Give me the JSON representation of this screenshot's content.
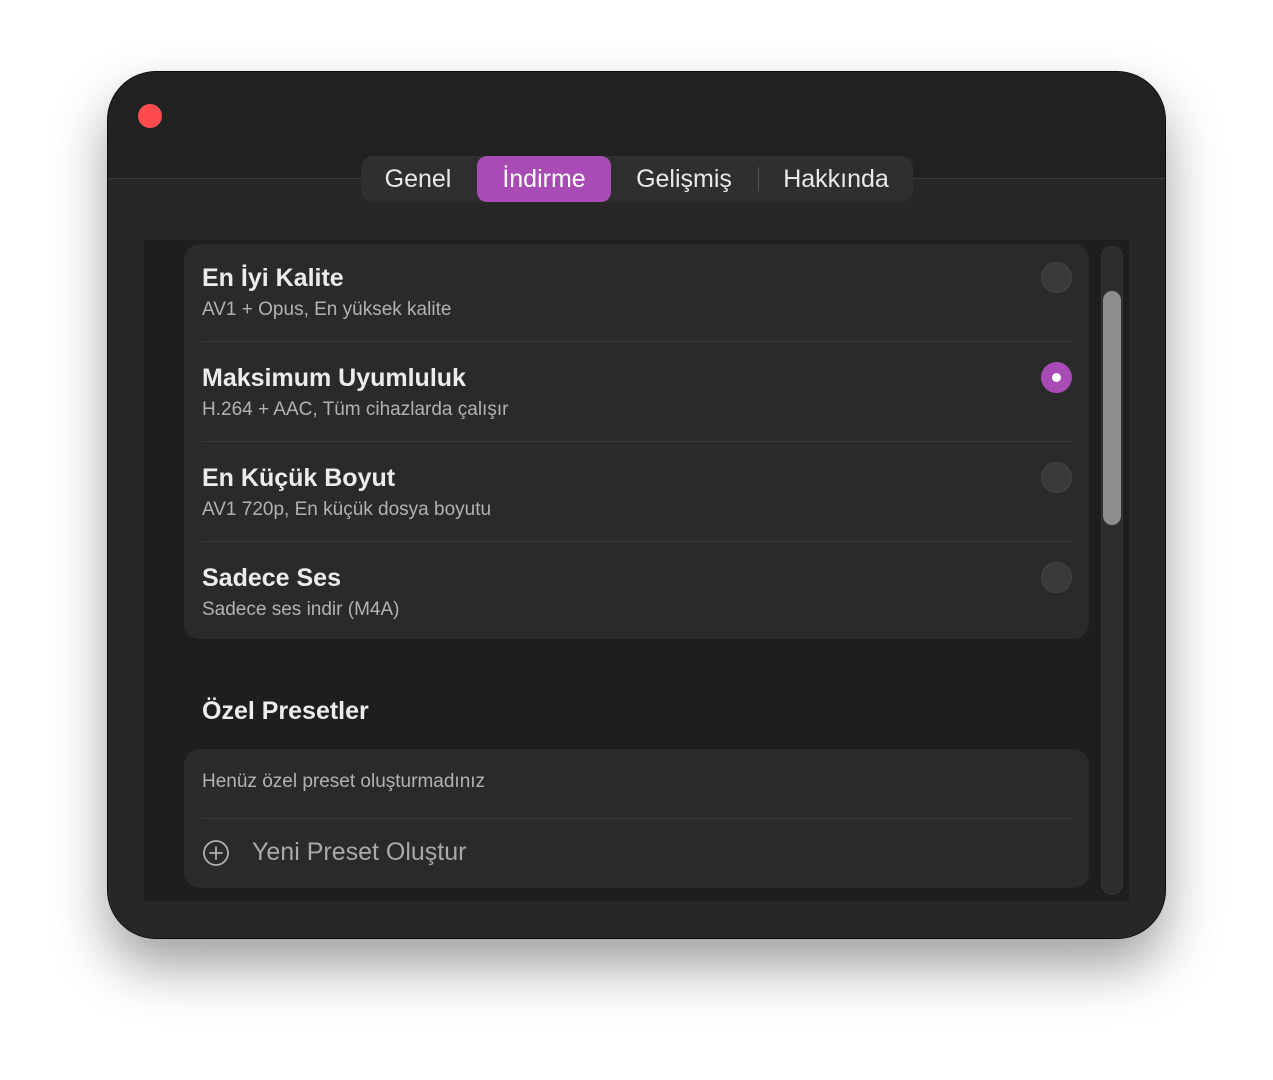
{
  "window": {
    "tabs": [
      {
        "label": "Genel",
        "active": false
      },
      {
        "label": "İndirme",
        "active": true
      },
      {
        "label": "Gelişmiş",
        "active": false
      },
      {
        "label": "Hakkında",
        "active": false
      }
    ]
  },
  "presets": [
    {
      "title": "En İyi Kalite",
      "subtitle": "AV1 + Opus, En yüksek kalite",
      "selected": false
    },
    {
      "title": "Maksimum Uyumluluk",
      "subtitle": "H.264 + AAC, Tüm cihazlarda çalışır",
      "selected": true
    },
    {
      "title": "En Küçük Boyut",
      "subtitle": "AV1 720p, En küçük dosya boyutu",
      "selected": false
    },
    {
      "title": "Sadece Ses",
      "subtitle": "Sadece ses indir (M4A)",
      "selected": false
    }
  ],
  "custom_presets": {
    "section_title": "Özel Presetler",
    "empty_text": "Henüz özel preset oluşturmadınız",
    "new_preset_label": "Yeni Preset Oluştur"
  },
  "scroll": {
    "visible_fraction": 0.36,
    "position_fraction": 0.07
  },
  "colors": {
    "accent": "#a84bb4",
    "close": "#fe4b4e",
    "window_bg": "#232323"
  }
}
